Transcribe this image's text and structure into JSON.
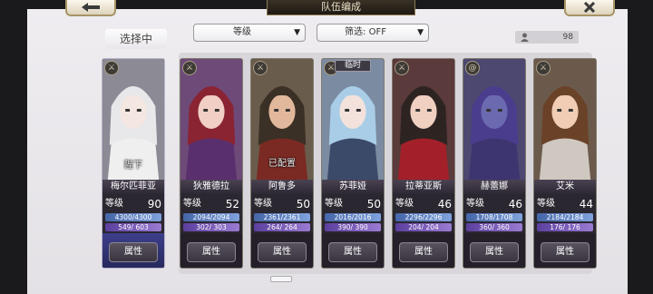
{
  "header": {
    "title": "队伍编成",
    "back_icon": "back-arrow-icon",
    "close_icon": "close-x-icon"
  },
  "filters": {
    "sort_label": "等级",
    "filter_label": "筛选: OFF"
  },
  "unit_count": "98",
  "selecting_label": "选择中",
  "stat_label": "等级",
  "attr_label": "属性",
  "cards": [
    {
      "name": "梅尔匹菲亚",
      "level": "90",
      "hp": "4300/4300",
      "mp": "549/ 603",
      "status": "陛下",
      "temp": "",
      "selected": true,
      "class_icon": "sword-icon",
      "hair": "#e8e8ea",
      "skin": "#f4e6e0",
      "cloth": "#f0eff0",
      "bg": "#8c8a94"
    },
    {
      "name": "狄雅德拉",
      "level": "52",
      "hp": "2094/2094",
      "mp": "302/ 303",
      "status": "",
      "temp": "",
      "selected": false,
      "class_icon": "sword-icon",
      "hair": "#8a2433",
      "skin": "#f1cfc4",
      "cloth": "#5a2f6e",
      "bg": "#6d4a78"
    },
    {
      "name": "阿鲁多",
      "level": "50",
      "hp": "2361/2361",
      "mp": "264/ 264",
      "status": "已配置",
      "temp": "",
      "selected": false,
      "class_icon": "sword-icon",
      "hair": "#3b3025",
      "skin": "#e2b89c",
      "cloth": "#7a2a22",
      "bg": "#6a5c4c"
    },
    {
      "name": "苏菲娅",
      "level": "50",
      "hp": "2016/2016",
      "mp": "390/ 390",
      "status": "",
      "temp": "临时",
      "selected": false,
      "class_icon": "sword-icon",
      "hair": "#a9cde6",
      "skin": "#f3e2dc",
      "cloth": "#3c4a6a",
      "bg": "#7b8ba1"
    },
    {
      "name": "拉蒂亚斯",
      "level": "46",
      "hp": "2296/2296",
      "mp": "204/ 204",
      "status": "",
      "temp": "",
      "selected": false,
      "class_icon": "sword-icon",
      "hair": "#2d2422",
      "skin": "#f0d0c0",
      "cloth": "#a3202a",
      "bg": "#5a3a3a"
    },
    {
      "name": "赫蕾娜",
      "level": "46",
      "hp": "1708/1708",
      "mp": "360/ 360",
      "status": "",
      "temp": "",
      "selected": false,
      "class_icon": "spiral-icon",
      "hair": "#4a3d8e",
      "skin": "#6b6ab0",
      "cloth": "#3d3570",
      "bg": "#4c4870"
    },
    {
      "name": "艾米",
      "level": "44",
      "hp": "2184/2184",
      "mp": "176/ 176",
      "status": "",
      "temp": "",
      "selected": false,
      "class_icon": "sword-icon",
      "hair": "#6a4228",
      "skin": "#f0cdb4",
      "cloth": "#cfc8c0",
      "bg": "#6b5a4c"
    }
  ]
}
